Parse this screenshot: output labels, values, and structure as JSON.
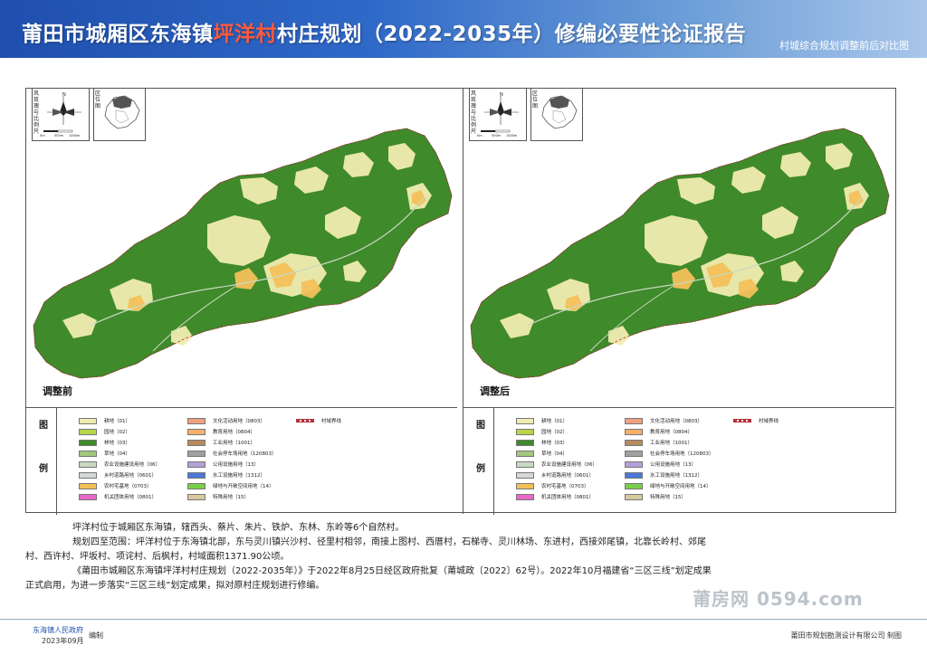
{
  "header": {
    "title_prefix": "莆田市城厢区东海镇",
    "title_highlight": "坪洋村",
    "title_suffix": "村庄规划（2022-2035年）修编必要性论证报告",
    "subtitle": "村城综合规划调整前后对比图"
  },
  "maps": {
    "compass_label": "风玫瑰与比例尺",
    "locator_label": "区位图",
    "scale_ticks": [
      "0m",
      "500m",
      "1000m"
    ],
    "before_caption": "调整前",
    "after_caption": "调整后"
  },
  "legend": {
    "label_top": "图",
    "label_bottom": "例",
    "columns": [
      [
        {
          "text": "耕地（01）",
          "color": "#f0ecb0"
        },
        {
          "text": "园地（02）",
          "color": "#b8d64a"
        },
        {
          "text": "林地（03）",
          "color": "#3f8a2a"
        },
        {
          "text": "草地（04）",
          "color": "#a3c77e"
        },
        {
          "text": "农业设施建设用地（06）",
          "color": "#c9d9c2"
        },
        {
          "text": "乡村道路用地（0601）",
          "color": "#d4d8d6"
        },
        {
          "text": "农村宅基地（0703）",
          "color": "#f4c05a"
        },
        {
          "text": "机关团体用地（0801）",
          "color": "#e868c8"
        }
      ],
      [
        {
          "text": "文化活动用地（0803）",
          "color": "#f0a080"
        },
        {
          "text": "教育用地（0804）",
          "color": "#f6b06a"
        },
        {
          "text": "工业用地（1001）",
          "color": "#b88a60"
        },
        {
          "text": "社会停车场用地（120803）",
          "color": "#a0a0a0"
        },
        {
          "text": "公用设施用地（13）",
          "color": "#b4a0d8"
        },
        {
          "text": "水工设施用地（1312）",
          "color": "#4a78d8"
        },
        {
          "text": "绿地与开敞空间用地（14）",
          "color": "#78d048"
        },
        {
          "text": "特殊用地（15）",
          "color": "#d8c8a0"
        }
      ],
      [
        {
          "text": "村域界线",
          "color": "#b0323a"
        }
      ]
    ]
  },
  "description": {
    "p1": "坪洋村位于城厢区东海镇，辖西头、蔡片、朱片、铁炉、东林、东岭等6个自然村。",
    "p2a": "规划四至范围：坪洋村位于东海镇北部，东与灵川镇兴沙村、径里村相邻，南接上图村、西厝村，石梯寺、灵川林场、东进村，西接郊尾镇，北靠长岭村、郊尾",
    "p2b": "村、西许村、坪坂村、项诧村、后枫村，村域面积1371.90公顷。",
    "p3a": "《莆田市城厢区东海镇坪洋村村庄规划（2022-2035年）》于2022年8月25日经区政府批复（莆城政〔2022〕62号）。2022年10月福建省“三区三线”划定成果",
    "p3b": "正式启用，为进一步落实“三区三线”划定成果，拟对原村庄规划进行修编。"
  },
  "watermark": "莆房网 0594.com",
  "footer": {
    "org": "东海镇人民政府",
    "date": "2023年09月",
    "edit": "编制",
    "maker": "莆田市规划勘测设计有限公司  制图"
  },
  "colors": {
    "forest": "#3f8a2a",
    "farmland": "#f0ecb0",
    "residential": "#f4c05a",
    "header_blue": "#1f4fae"
  }
}
